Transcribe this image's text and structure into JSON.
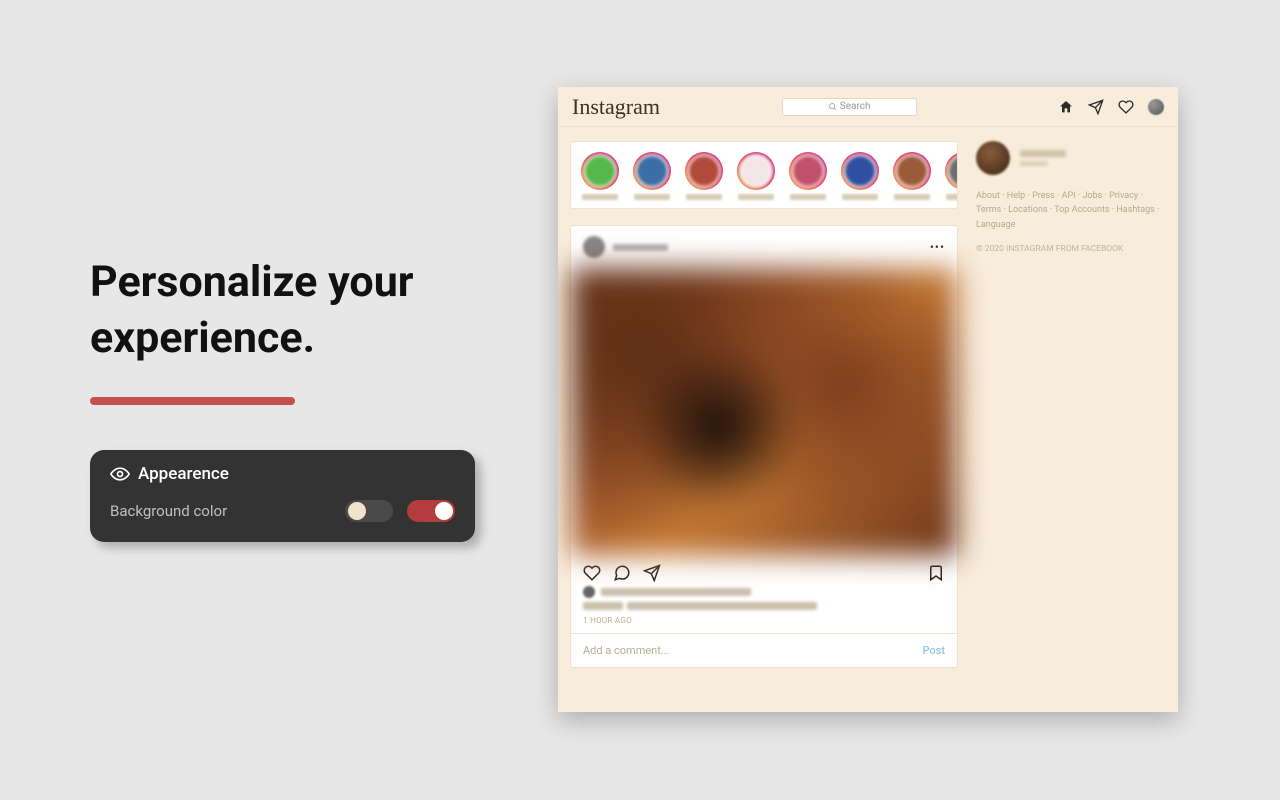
{
  "promo": {
    "headline": "Personalize your experience.",
    "panel": {
      "title": "Appearence",
      "row_label": "Background color"
    }
  },
  "app": {
    "logo": "Instagram",
    "search_placeholder": "Search",
    "story_colors": [
      "#57b84a",
      "#3a6ea5",
      "#b24a3a",
      "#f3e6e6",
      "#c2506a",
      "#2f4fa0",
      "#9a5b3a",
      "#6e6e6e"
    ],
    "post": {
      "timestamp": "1 HOUR AGO",
      "comment_placeholder": "Add a comment...",
      "post_button": "Post"
    },
    "footer_links": [
      "About",
      "Help",
      "Press",
      "API",
      "Jobs",
      "Privacy",
      "Terms",
      "Locations",
      "Top Accounts",
      "Hashtags",
      "Language"
    ],
    "copyright": "© 2020 INSTAGRAM FROM FACEBOOK"
  }
}
